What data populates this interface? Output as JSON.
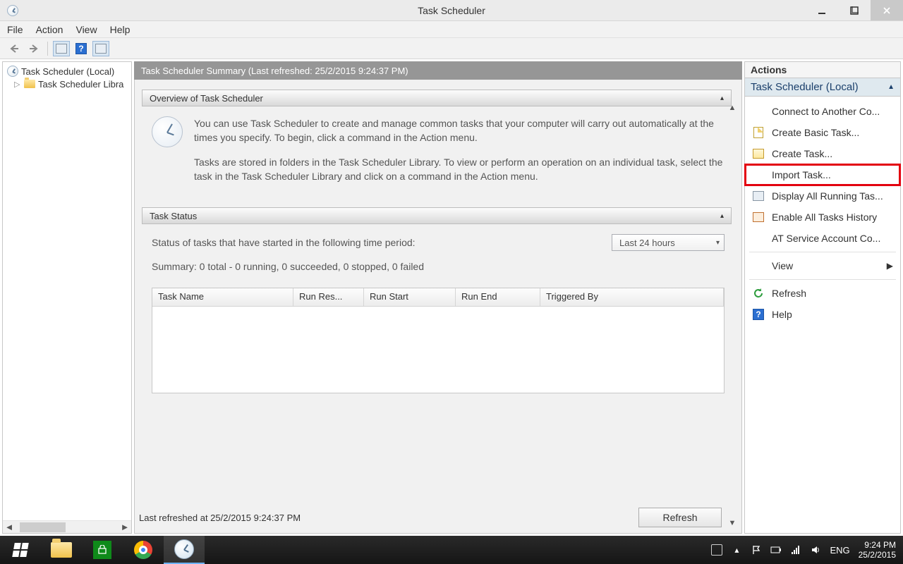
{
  "titlebar": {
    "title": "Task Scheduler"
  },
  "menu": {
    "file": "File",
    "action": "Action",
    "view": "View",
    "help": "Help"
  },
  "tree": {
    "root": "Task Scheduler (Local)",
    "library": "Task Scheduler Libra"
  },
  "summary": {
    "header": "Task Scheduler Summary (Last refreshed: 25/2/2015 9:24:37 PM)",
    "overview_title": "Overview of Task Scheduler",
    "overview_p1": "You can use Task Scheduler to create and manage common tasks that your computer will carry out automatically at the times you specify. To begin, click a command in the Action menu.",
    "overview_p2": "Tasks are stored in folders in the Task Scheduler Library. To view or perform an operation on an individual task, select the task in the Task Scheduler Library and click on a command in the Action menu.",
    "status_title": "Task Status",
    "status_line": "Status of tasks that have started in the following time period:",
    "period_selected": "Last 24 hours",
    "summary_line": "Summary: 0 total - 0 running, 0 succeeded, 0 stopped, 0 failed",
    "cols": {
      "name": "Task Name",
      "res": "Run Res...",
      "start": "Run Start",
      "end": "Run End",
      "trig": "Triggered By"
    },
    "last_refreshed": "Last refreshed at 25/2/2015 9:24:37 PM",
    "refresh_btn": "Refresh"
  },
  "actions": {
    "title": "Actions",
    "subtitle": "Task Scheduler (Local)",
    "items": {
      "connect": "Connect to Another Co...",
      "create_basic": "Create Basic Task...",
      "create_task": "Create Task...",
      "import_task": "Import Task...",
      "display_running": "Display All Running Tas...",
      "enable_history": "Enable All Tasks History",
      "at_service": "AT Service Account Co...",
      "view": "View",
      "refresh": "Refresh",
      "help": "Help"
    }
  },
  "taskbar": {
    "lang": "ENG",
    "time": "9:24 PM",
    "date": "25/2/2015"
  }
}
